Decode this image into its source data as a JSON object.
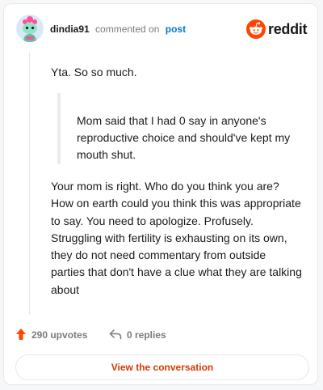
{
  "header": {
    "username": "dindia91",
    "commented_on": "commented on",
    "post_link": "post",
    "brand": "reddit"
  },
  "comment": {
    "opening": "Yta. So so much.",
    "quote": "Mom said that I had 0 say in anyone's reproductive choice and should've kept my mouth shut.",
    "body": "Your mom is right. Who do you think you are? How on earth could you think this was appropriate to say. You need to apologize. Profusely. Struggling with fertility is exhausting on its own, they do not need commentary from outside parties that don't have a clue what they are talking about"
  },
  "actions": {
    "upvotes": "290 upvotes",
    "replies": "0 replies"
  },
  "cta": {
    "label": "View the conversation"
  },
  "colors": {
    "accent": "#d93a00",
    "link": "#0079d3",
    "upvote": "#ff4500",
    "muted": "#787c7e"
  },
  "icons": {
    "avatar": "snoo-avatar",
    "brand": "reddit-logo-icon",
    "upvote": "arrow-up-icon",
    "reply": "reply-arrow-icon"
  }
}
